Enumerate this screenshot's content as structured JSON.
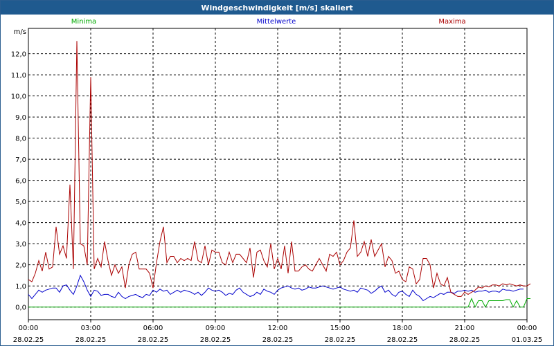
{
  "window": {
    "title": "Windgeschwindigkeit [m/s] skaliert"
  },
  "chart_data": {
    "type": "line",
    "title": "Windgeschwindigkeit [m/s] skaliert",
    "ylabel": "m/s",
    "xlabel": "",
    "ylim": [
      -0.6,
      13.2
    ],
    "xlim": [
      "28.02.25 00:00",
      "01.03.25 00:00"
    ],
    "grid": true,
    "legend_placement": "top",
    "y_ticks": [
      "0,0",
      "1,0",
      "2,0",
      "3,0",
      "4,0",
      "5,0",
      "6,0",
      "7,0",
      "8,0",
      "9,0",
      "10,0",
      "11,0",
      "12,0"
    ],
    "x_tick_times": [
      "00:00",
      "03:00",
      "06:00",
      "09:00",
      "12:00",
      "15:00",
      "18:00",
      "21:00",
      "00:00"
    ],
    "x_tick_dates": [
      "28.02.25",
      "28.02.25",
      "28.02.25",
      "28.02.25",
      "28.02.25",
      "28.02.25",
      "28.02.25",
      "28.02.25",
      "01.03.25"
    ],
    "sample_interval_minutes": 10,
    "series": [
      {
        "name": "Minima",
        "color": "#00aa00",
        "values": [
          0,
          0,
          0,
          0,
          0,
          0,
          0,
          0,
          0,
          0,
          0,
          0,
          0,
          0,
          0,
          0,
          0,
          0,
          0,
          0,
          0,
          0,
          0,
          0,
          0,
          0,
          0,
          0,
          0,
          0,
          0,
          0,
          0,
          0,
          0,
          0,
          0,
          0,
          0,
          0,
          0,
          0,
          0,
          0,
          0,
          0,
          0,
          0,
          0,
          0,
          0,
          0,
          0,
          0,
          0,
          0,
          0,
          0,
          0,
          0,
          0,
          0,
          0,
          0,
          0,
          0,
          0,
          0,
          0,
          0,
          0,
          0,
          0,
          0,
          0,
          0,
          0,
          0,
          0,
          0,
          0,
          0,
          0,
          0,
          0,
          0,
          0,
          0,
          0,
          0,
          0,
          0,
          0,
          0,
          0,
          0,
          0,
          0,
          0,
          0,
          0,
          0,
          0,
          0,
          0,
          0,
          0,
          0,
          0,
          0,
          0,
          0,
          0,
          0,
          0,
          0,
          0,
          0,
          0,
          0,
          0,
          0,
          0,
          0,
          0,
          0,
          0,
          0,
          0.4,
          0,
          0.3,
          0.3,
          0,
          0.3,
          0.3,
          0.3,
          0.3,
          0.3,
          0.35,
          0.35,
          0,
          0.3,
          0,
          0,
          0.4,
          0.4
        ]
      },
      {
        "name": "Mittelwerte",
        "color": "#0000cc",
        "values": [
          0.6,
          0.4,
          0.6,
          0.8,
          0.7,
          0.8,
          0.85,
          0.9,
          0.9,
          0.7,
          1.0,
          1.05,
          0.8,
          0.6,
          1.0,
          1.5,
          1.2,
          0.8,
          0.5,
          0.8,
          0.75,
          0.55,
          0.6,
          0.6,
          0.5,
          0.45,
          0.7,
          0.5,
          0.4,
          0.5,
          0.55,
          0.6,
          0.5,
          0.45,
          0.6,
          0.55,
          0.8,
          0.7,
          0.85,
          0.75,
          0.8,
          0.6,
          0.7,
          0.8,
          0.7,
          0.8,
          0.75,
          0.7,
          0.6,
          0.7,
          0.55,
          0.7,
          0.9,
          0.8,
          0.75,
          0.8,
          0.7,
          0.55,
          0.65,
          0.6,
          0.8,
          0.9,
          0.7,
          0.6,
          0.5,
          0.55,
          0.7,
          0.6,
          0.85,
          0.75,
          0.7,
          0.6,
          0.8,
          0.9,
          0.95,
          1.0,
          0.9,
          0.85,
          0.9,
          0.8,
          0.85,
          0.95,
          0.9,
          0.9,
          0.95,
          1.0,
          0.95,
          0.9,
          0.85,
          0.9,
          0.95,
          0.85,
          0.8,
          0.75,
          0.8,
          0.7,
          0.9,
          0.85,
          0.8,
          0.65,
          0.75,
          0.9,
          1.0,
          0.7,
          0.8,
          0.6,
          0.5,
          0.7,
          0.75,
          0.6,
          0.5,
          0.8,
          0.6,
          0.5,
          0.3,
          0.4,
          0.5,
          0.45,
          0.55,
          0.65,
          0.6,
          0.7,
          0.7,
          0.65,
          0.75,
          0.75,
          0.8,
          0.75,
          0.8,
          0.7,
          0.75,
          0.75,
          0.8,
          0.7,
          0.75,
          0.75,
          0.7,
          0.85,
          0.8,
          0.8,
          0.75,
          0.8,
          0.85,
          0.85
        ]
      },
      {
        "name": "Maxima",
        "color": "#aa0000",
        "values": [
          1.3,
          1.2,
          1.6,
          2.2,
          1.7,
          2.6,
          1.8,
          1.9,
          3.8,
          2.5,
          2.9,
          2.3,
          5.8,
          1.8,
          12.6,
          3.0,
          2.9,
          2.0,
          10.9,
          1.8,
          2.3,
          1.9,
          3.1,
          2.2,
          1.5,
          2.0,
          1.6,
          1.9,
          0.9,
          2.0,
          2.5,
          2.6,
          1.8,
          1.8,
          1.8,
          1.6,
          0.9,
          2.1,
          3.1,
          3.8,
          2.1,
          2.4,
          2.4,
          2.1,
          2.3,
          2.2,
          2.3,
          2.2,
          3.1,
          2.2,
          2.1,
          2.9,
          2.0,
          2.7,
          2.6,
          2.6,
          2.1,
          2.0,
          2.6,
          2.1,
          2.5,
          2.5,
          2.3,
          2.1,
          2.8,
          1.4,
          2.6,
          2.7,
          2.2,
          1.9,
          3.0,
          1.8,
          2.3,
          1.8,
          2.9,
          1.6,
          3.1,
          1.7,
          1.7,
          1.9,
          2.0,
          1.8,
          1.7,
          2.0,
          2.3,
          2.0,
          1.7,
          2.5,
          2.4,
          2.6,
          2.0,
          2.2,
          2.6,
          2.8,
          4.1,
          2.4,
          2.6,
          3.1,
          2.4,
          3.2,
          2.4,
          2.7,
          3.0,
          1.9,
          2.4,
          2.2,
          1.6,
          1.7,
          1.3,
          1.2,
          1.9,
          1.8,
          1.1,
          1.3,
          2.3,
          2.3,
          2.0,
          0.9,
          1.6,
          1.1,
          1.0,
          1.4,
          0.7,
          0.6,
          0.5,
          0.5,
          0.7,
          0.6,
          0.7,
          0.8,
          0.95,
          0.9,
          1.0,
          0.95,
          1.05,
          1.05,
          1.0,
          1.1,
          1.05,
          1.1,
          1.05,
          1.0,
          1.05,
          1.0,
          1.0,
          1.1
        ]
      }
    ]
  }
}
